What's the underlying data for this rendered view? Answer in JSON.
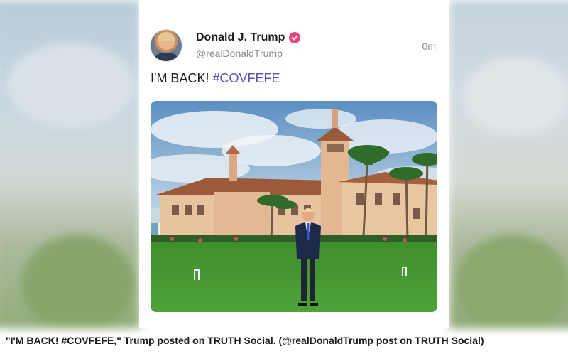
{
  "post": {
    "author_name": "Donald J. Trump",
    "author_handle": "@realDonaldTrump",
    "time_ago": "0m",
    "text_main": "I'M BACK!",
    "hashtag": "#COVFEFE",
    "verified_badge_color": "#e5487b",
    "hashtag_color": "#5b4fb8"
  },
  "photo": {
    "icon": "mansion-lawn-photo"
  },
  "caption": {
    "text": "\"I'M BACK! #COVFEFE,\" Trump posted on TRUTH Social. (@realDonaldTrump post on TRUTH Social)"
  }
}
